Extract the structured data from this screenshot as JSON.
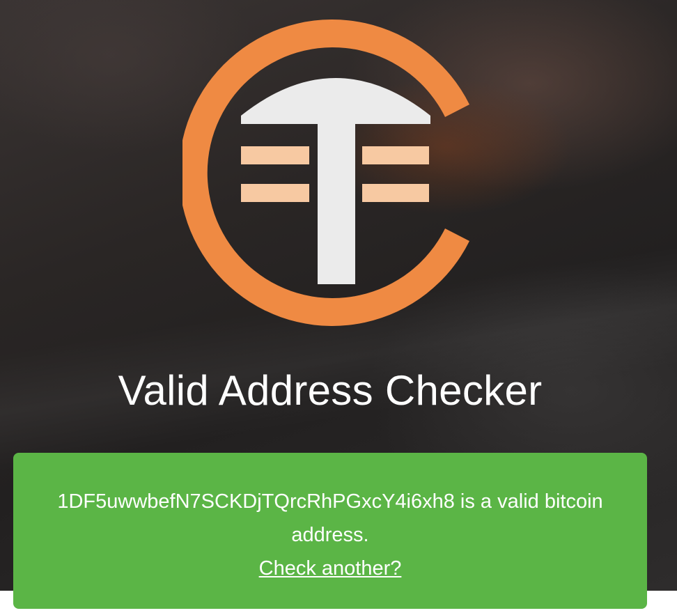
{
  "page": {
    "title": "Valid Address Checker"
  },
  "result": {
    "address": "1DF5uwwbefN7SCKDjTQrcRhPGxcY4i6xh8",
    "message_suffix": " is a valid bitcoin address.",
    "check_another_label": "Check another?",
    "status": "valid"
  },
  "colors": {
    "logo_orange": "#ef8a43",
    "logo_bars": "#f7c9a2",
    "logo_t": "#ebebeb",
    "success_green": "#5bb546"
  },
  "icons": {
    "logo": "ct-monogram-logo"
  }
}
